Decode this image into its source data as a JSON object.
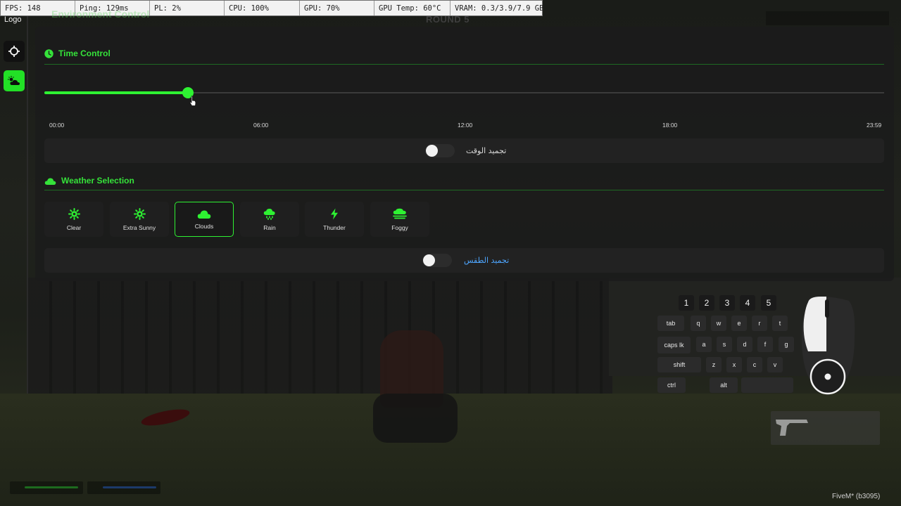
{
  "perf_overlay": {
    "fps": "FPS: 148",
    "ping": "Ping: 129ms",
    "pl": "PL: 2%",
    "cpu": "CPU: 100%",
    "gpu": "GPU: 70%",
    "gpu_temp": "GPU Temp: 60°C",
    "vram": "VRAM: 0.3/3.9/7.9 GB"
  },
  "logo": "Logo",
  "panel": {
    "title": "Environment Control"
  },
  "background": {
    "round": "ROUND 5"
  },
  "time_control": {
    "heading": "Time Control",
    "ticks": [
      "00:00",
      "06:00",
      "12:00",
      "18:00",
      "23:59"
    ],
    "slider_fraction": 0.171,
    "freeze_label": "تجميد الوقت",
    "freeze_on": false
  },
  "weather_selection": {
    "heading": "Weather Selection",
    "options": [
      {
        "label": "Clear",
        "icon": "sun-icon",
        "selected": false
      },
      {
        "label": "Extra Sunny",
        "icon": "sun-icon",
        "selected": false
      },
      {
        "label": "Clouds",
        "icon": "cloud-icon",
        "selected": true
      },
      {
        "label": "Rain",
        "icon": "rain-cloud-icon",
        "selected": false
      },
      {
        "label": "Thunder",
        "icon": "lightning-icon",
        "selected": false
      },
      {
        "label": "Foggy",
        "icon": "fog-icon",
        "selected": false
      }
    ],
    "freeze_label": "تجميد الطقس",
    "freeze_on": false
  },
  "keyboard_hud": {
    "numbers": [
      "1",
      "2",
      "3",
      "4",
      "5"
    ],
    "row1": [
      "tab",
      "q",
      "w",
      "e",
      "r",
      "t"
    ],
    "row2": [
      "caps lk",
      "a",
      "s",
      "d",
      "f",
      "g"
    ],
    "row3": [
      "shift",
      "z",
      "x",
      "c",
      "v"
    ],
    "row4": [
      "ctrl",
      "alt"
    ]
  },
  "client": {
    "label": "FiveM* (b3095)"
  },
  "colors": {
    "accent": "#2ef232",
    "heading": "#35e23a",
    "panel_bg": "#1c1c1c",
    "freeze_weather_label": "#4ea6ff",
    "freeze_time_label": "#d9d9d9"
  }
}
